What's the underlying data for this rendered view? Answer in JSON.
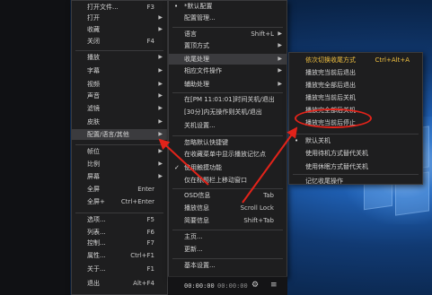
{
  "main_menu": {
    "items": [
      {
        "label": "打开文件...",
        "shortcut": "F3"
      },
      {
        "label": "打开",
        "arrow": true
      },
      {
        "label": "收藏",
        "arrow": true
      },
      {
        "label": "关闭",
        "shortcut": "F4"
      },
      {
        "label": "播放",
        "arrow": true
      },
      {
        "label": "字幕",
        "arrow": true
      },
      {
        "label": "视频",
        "arrow": true
      },
      {
        "label": "声音",
        "arrow": true
      },
      {
        "label": "滤镜",
        "arrow": true
      },
      {
        "label": "皮肤",
        "arrow": true
      },
      {
        "label": "配置/语言/其他",
        "arrow": true
      },
      {
        "label": "帧位",
        "arrow": true
      },
      {
        "label": "比例",
        "arrow": true
      },
      {
        "label": "屏幕",
        "arrow": true
      },
      {
        "label": "全屏",
        "shortcut": "Enter"
      },
      {
        "label": "全屏+",
        "shortcut": "Ctrl+Enter"
      },
      {
        "label": "选项...",
        "shortcut": "F5"
      },
      {
        "label": "列表...",
        "shortcut": "F6"
      },
      {
        "label": "控制...",
        "shortcut": "F7"
      },
      {
        "label": "属性...",
        "shortcut": "Ctrl+F1"
      },
      {
        "label": "关于...",
        "shortcut": "F1"
      },
      {
        "label": "退出",
        "shortcut": "Alt+F4"
      }
    ]
  },
  "sub_menu": {
    "items": [
      {
        "label": "*默认配置"
      },
      {
        "label": "配置管理..."
      },
      {
        "label": "语言",
        "shortcut": "Shift+L",
        "arrow": true
      },
      {
        "label": "置顶方式",
        "arrow": true
      },
      {
        "label": "收尾处理",
        "arrow": true
      },
      {
        "label": "相应文件操作",
        "arrow": true
      },
      {
        "label": "辅助处理",
        "arrow": true
      },
      {
        "label": "在[PM 11:01:01]时间关机/退出"
      },
      {
        "label": "[30分]内无操作则关机/退出"
      },
      {
        "label": "关机设置..."
      },
      {
        "label": "忽略默认快捷键"
      },
      {
        "label": "在收藏菜单中显示播放记忆点"
      },
      {
        "label": "使用触摸功能"
      },
      {
        "label": "仅在标题栏上移动窗口"
      },
      {
        "label": "OSD信息",
        "shortcut": "Tab"
      },
      {
        "label": "播放信息",
        "shortcut": "Scroll Lock"
      },
      {
        "label": "简要信息",
        "shortcut": "Shift+Tab"
      },
      {
        "label": "主页..."
      },
      {
        "label": "更新..."
      },
      {
        "label": "基本设置..."
      }
    ]
  },
  "end_menu": {
    "items": [
      {
        "label": "依次切换收尾方式",
        "shortcut": "Ctrl+Alt+A"
      },
      {
        "label": "播放完当前后退出"
      },
      {
        "label": "播放完全部后退出"
      },
      {
        "label": "播放完当前后关机"
      },
      {
        "label": "播放完全部后关机"
      },
      {
        "label": "播放完当前后停止"
      },
      {
        "label": "默认关机"
      },
      {
        "label": "使用待机方式替代关机"
      },
      {
        "label": "使用休眠方式替代关机"
      },
      {
        "label": "记忆收尾操作"
      }
    ]
  },
  "player_bar": {
    "time_current": "00:00:00",
    "time_total": "00:00:00"
  },
  "colors": {
    "highlight_text": "#f0c040",
    "annotation_red": "#e2231a"
  }
}
